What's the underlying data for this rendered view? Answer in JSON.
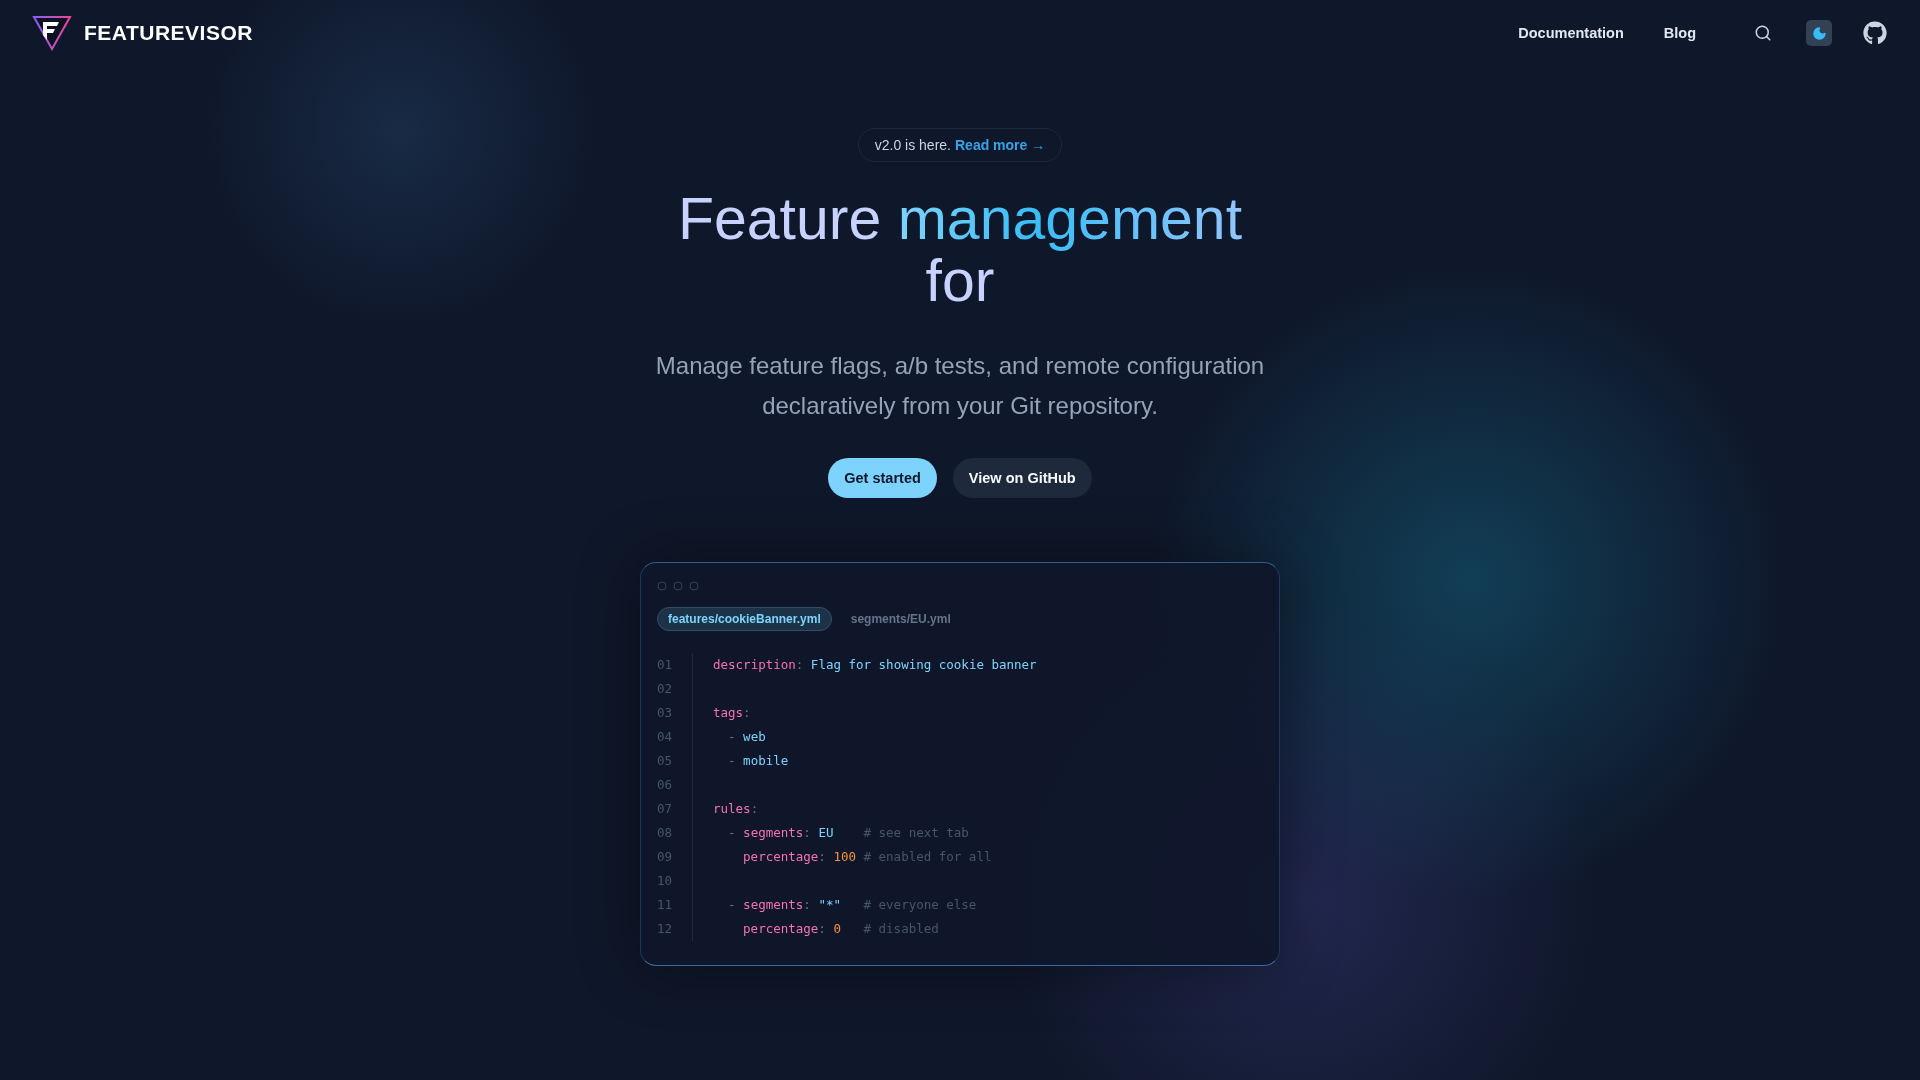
{
  "nav": {
    "brand": "FEATUREVISOR",
    "links": [
      "Documentation",
      "Blog"
    ],
    "theme_toggle": {
      "on": true
    }
  },
  "announcement": {
    "text": "v2.0 is here.",
    "link": "Read more →"
  },
  "hero": {
    "lead": "Feature",
    "highlight": "management",
    "tail": "for",
    "subtitle": "Manage feature flags, a/b tests, and remote configuration declaratively from your Git repository."
  },
  "buttons": [
    {
      "label": "Get started",
      "kind": "primary"
    },
    {
      "label": "View on GitHub",
      "kind": "secondary"
    }
  ],
  "editor": {
    "tabs": [
      {
        "label": "features/cookieBanner.yml",
        "selected": true
      },
      {
        "label": "segments/EU.yml",
        "selected": false
      }
    ],
    "lines": [
      {
        "number": "01",
        "kind": "top",
        "tokens": [
          {
            "kind": "key",
            "text": "description"
          },
          {
            "kind": "punct",
            "text": ": "
          },
          {
            "kind": "string",
            "text": "Flag for showing cookie banner"
          }
        ]
      },
      {
        "number": "02"
      },
      {
        "number": "03",
        "kind": "top",
        "tokens": [
          {
            "kind": "key",
            "text": "tags"
          },
          {
            "kind": "punct",
            "text": ":"
          }
        ]
      },
      {
        "number": "04",
        "kind": "item",
        "tokens": [
          {
            "kind": "punct",
            "text": "- "
          },
          {
            "kind": "string",
            "text": "web"
          }
        ]
      },
      {
        "number": "05",
        "kind": "item",
        "tokens": [
          {
            "kind": "punct",
            "text": "- "
          },
          {
            "kind": "string",
            "text": "mobile"
          }
        ]
      },
      {
        "number": "06"
      },
      {
        "number": "07",
        "kind": "top",
        "tokens": [
          {
            "kind": "key",
            "text": "rules"
          },
          {
            "kind": "punct",
            "text": ":"
          }
        ]
      },
      {
        "number": "08",
        "kind": "item",
        "tokens": [
          {
            "kind": "punct",
            "text": "- "
          },
          {
            "kind": "key",
            "text": "segments"
          },
          {
            "kind": "punct",
            "text": ": "
          },
          {
            "kind": "string",
            "text": "EU"
          }
        ],
        "comment": "# see next tab"
      },
      {
        "number": "09",
        "kind": "nested",
        "tokens": [
          {
            "kind": "key",
            "text": "percentage"
          },
          {
            "kind": "punct",
            "text": ": "
          },
          {
            "kind": "number",
            "text": "100"
          }
        ],
        "comment": "# enabled for all"
      },
      {
        "number": "10"
      },
      {
        "number": "11",
        "kind": "item",
        "tokens": [
          {
            "kind": "punct",
            "text": "- "
          },
          {
            "kind": "key",
            "text": "segments"
          },
          {
            "kind": "punct",
            "text": ": "
          },
          {
            "kind": "string",
            "text": "\"*\""
          }
        ],
        "comment": "# everyone else"
      },
      {
        "number": "12",
        "kind": "nested",
        "tokens": [
          {
            "kind": "key",
            "text": "percentage"
          },
          {
            "kind": "punct",
            "text": ": "
          },
          {
            "kind": "number",
            "text": "0"
          }
        ],
        "comment": "# disabled"
      }
    ]
  }
}
